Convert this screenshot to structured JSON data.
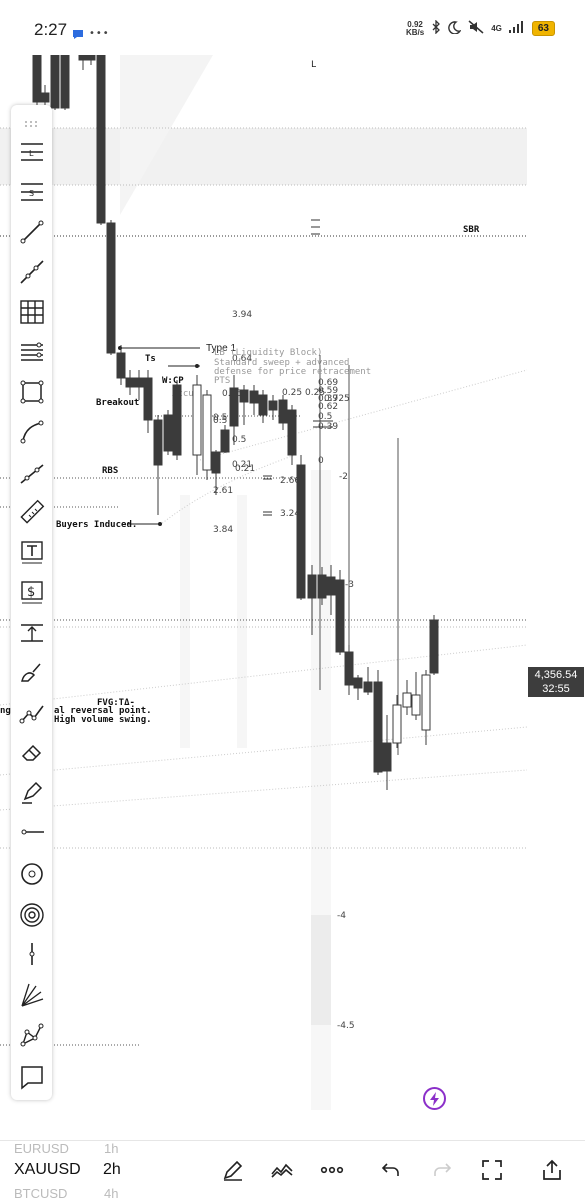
{
  "status": {
    "time": "2:27",
    "net_speed_value": "0.92",
    "net_speed_unit": "KB/s",
    "network": "4G",
    "battery": "63",
    "icons": [
      "chat-icon",
      "dots-icon",
      "bluetooth-icon",
      "moon-icon",
      "mute-icon",
      "signal-icon",
      "battery-icon"
    ]
  },
  "chart": {
    "annotations": {
      "type1": "Type 1",
      "ts": "Ts",
      "wcp": "W:CP",
      "breakout": "Breakout",
      "rbs": "RBS",
      "buyers_induced": "Buyers Induced.",
      "sbr": "SBR",
      "fvg": "FVG:TΔ-",
      "reversal": "al reversal point.",
      "reversal_prefix": "ng",
      "high_volume": "High volume swing.",
      "liquidity_block": "LB (Liquidity Block)",
      "standard_sweep": "Standard sweep + advanced",
      "defense": "defense for price retracement",
      "pts": "PTS",
      "accu": "Accu",
      "l_mark": "L"
    },
    "fib_levels": [
      "0.69",
      "0.59",
      "0.39",
      "0.725",
      "0.62",
      "0.5",
      "0.39",
      "0"
    ],
    "misc_numbers": [
      "3.94",
      "0.64",
      "0.25",
      "0.5",
      "0.21",
      "0.5",
      "-2",
      "-3",
      "-4",
      "-4.5",
      "2.66",
      "3.24",
      "3.84",
      "0.25",
      "0.5",
      "0.21",
      "2.61",
      "0.25"
    ],
    "current_price": "4,356.54",
    "countdown": "32:55"
  },
  "toolbar": {
    "tools": [
      "horizontal-line-l-icon",
      "horizontal-line-s-icon",
      "trend-line-icon",
      "ray-icon",
      "grid-icon",
      "parallel-channel-icon",
      "rectangle-icon",
      "curve-icon",
      "extended-line-icon",
      "ruler-icon",
      "text-icon",
      "price-label-icon",
      "long-position-icon",
      "brush-icon",
      "polyline-icon",
      "eraser-icon",
      "highlighter-icon",
      "horizontal-ray-icon",
      "circle-icon",
      "spiral-icon",
      "vertical-line-icon",
      "fib-fan-icon",
      "pattern-icon",
      "comment-icon"
    ]
  },
  "bottom": {
    "prev_symbol": "EURUSD",
    "prev_tf": "1h",
    "symbol": "XAUUSD",
    "timeframe": "2h",
    "next_symbol": "BTCUSD",
    "next_tf": "4h",
    "buttons": [
      "pen-icon",
      "indicators-icon",
      "more-icon",
      "undo-icon",
      "redo-icon",
      "fullscreen-icon",
      "share-icon"
    ]
  },
  "colors": {
    "candle": "#3b3b3b",
    "price_tag": "#3d3d3d",
    "zone": "#efefef",
    "flash": "#8b2fc9"
  }
}
